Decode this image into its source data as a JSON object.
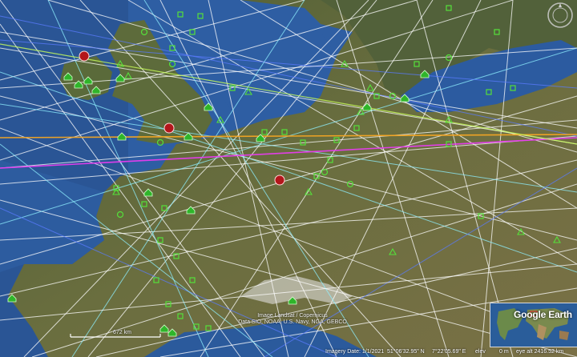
{
  "map": {
    "attribution": [
      "Image Landsat / Copernicus",
      "Data SIO, NOAA, U.S. Navy, NGA, GEBCO"
    ],
    "scale_label": "672 km"
  },
  "status_bar": {
    "imagery_date": "Imagery Date: 1/1/2021",
    "latitude": "51°06'32.95\" N",
    "longitude": "7°22'05.69\" E",
    "elevation_label": "elev",
    "elevation_value": "0 m",
    "eye_alt": "eye alt 2416.52 km"
  },
  "overview_map": {
    "logo": "Google Earth"
  },
  "icons": {
    "navigation": "compass-icon",
    "red_marker": "red-placemark-icon",
    "green_square": "green-square-marker-icon",
    "green_triangle": "green-triangle-marker-icon",
    "green_house": "green-house-marker-icon",
    "green_circle": "green-circle-marker-icon"
  },
  "colors": {
    "sea": "#2b5ea8",
    "land": "#5b6a3a",
    "line_white": "#ffffff",
    "line_cyan": "#8ff0ff",
    "line_blue": "#5a7bff",
    "line_orange": "#f5a623",
    "line_magenta": "#e83cf0",
    "marker_green": "#55e03a"
  }
}
